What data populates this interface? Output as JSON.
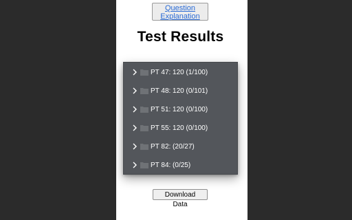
{
  "header": {
    "question_button_line1": "Question",
    "question_button_line2": "Explanation",
    "title": "Test Results"
  },
  "tree": {
    "items": [
      {
        "label": "PT 47: 120 (1/100)",
        "icon": "folder-icon",
        "expand_icon": "chevron-right-icon"
      },
      {
        "label": "PT 48: 120 (0/101)",
        "icon": "folder-icon",
        "expand_icon": "chevron-right-icon"
      },
      {
        "label": "PT 51: 120 (0/100)",
        "icon": "folder-icon",
        "expand_icon": "chevron-right-icon"
      },
      {
        "label": "PT 55: 120 (0/100)",
        "icon": "folder-icon",
        "expand_icon": "chevron-right-icon"
      },
      {
        "label": "PT 82: (20/27)",
        "icon": "folder-icon",
        "expand_icon": "chevron-right-icon"
      },
      {
        "label": "PT 84: (0/25)",
        "icon": "folder-icon",
        "expand_icon": "chevron-right-icon"
      }
    ]
  },
  "footer": {
    "download_label": "Download Data"
  },
  "colors": {
    "backdrop": "#2b2b2b",
    "panel": "#ffffff",
    "tree_background": "#53565b",
    "link": "#2a6bd6",
    "folder": "#6f7276"
  }
}
